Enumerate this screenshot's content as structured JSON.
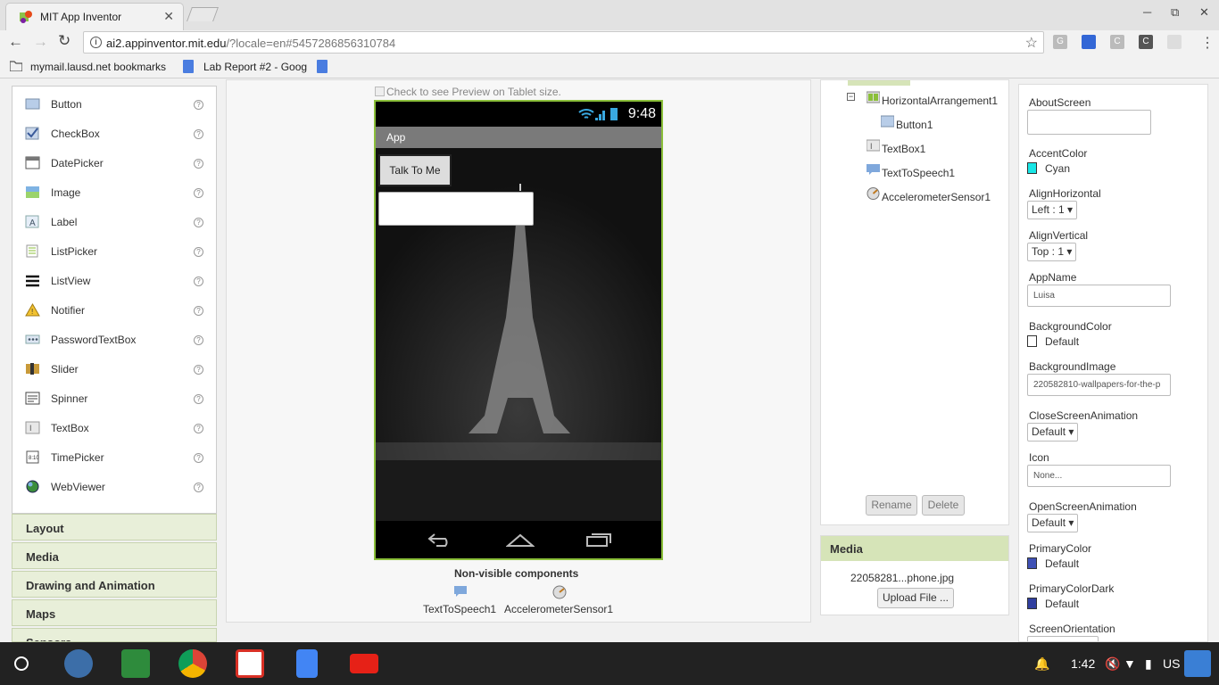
{
  "browser": {
    "tab_title": "MIT App Inventor",
    "tab_close": "✕",
    "url_main": "ai2.appinventor.mit.edu",
    "url_rest": "/?locale=en#5457286856310784",
    "bookmarks": [
      "mymail.lausd.net bookmarks",
      "Lab Report #2 - Goog"
    ]
  },
  "palette": {
    "items": [
      {
        "label": "Button",
        "icon": "button-icon"
      },
      {
        "label": "CheckBox",
        "icon": "checkbox-icon"
      },
      {
        "label": "DatePicker",
        "icon": "datepicker-icon"
      },
      {
        "label": "Image",
        "icon": "image-icon"
      },
      {
        "label": "Label",
        "icon": "label-icon"
      },
      {
        "label": "ListPicker",
        "icon": "listpicker-icon"
      },
      {
        "label": "ListView",
        "icon": "listview-icon"
      },
      {
        "label": "Notifier",
        "icon": "notifier-icon"
      },
      {
        "label": "PasswordTextBox",
        "icon": "passwordtextbox-icon"
      },
      {
        "label": "Slider",
        "icon": "slider-icon"
      },
      {
        "label": "Spinner",
        "icon": "spinner-icon"
      },
      {
        "label": "TextBox",
        "icon": "textbox-icon"
      },
      {
        "label": "TimePicker",
        "icon": "timepicker-icon"
      },
      {
        "label": "WebViewer",
        "icon": "webviewer-icon"
      }
    ],
    "help": "?",
    "drawers": [
      "Layout",
      "Media",
      "Drawing and Animation",
      "Maps",
      "Sensors"
    ]
  },
  "viewer": {
    "tablet_check": "Check to see Preview on Tablet size.",
    "time": "9:48",
    "app_title": "App",
    "button_text": "Talk To Me",
    "nonvisible_title": "Non-visible components",
    "nonvisible": [
      "TextToSpeech1",
      "AccelerometerSensor1"
    ]
  },
  "tree": {
    "nodes": [
      "HorizontalArrangement1",
      "Button1",
      "TextBox1",
      "TextToSpeech1",
      "AccelerometerSensor1"
    ],
    "rename": "Rename",
    "delete": "Delete"
  },
  "media": {
    "title": "Media",
    "file": "22058281...phone.jpg",
    "upload": "Upload File ..."
  },
  "properties": {
    "about": "AboutScreen",
    "accent_label": "AccentColor",
    "accent_value": "Cyan",
    "accent_color": "#18e6e6",
    "alignh_label": "AlignHorizontal",
    "alignh_value": "Left : 1 ▾",
    "alignv_label": "AlignVertical",
    "alignv_value": "Top : 1 ▾",
    "appname_label": "AppName",
    "appname_value": "Luisa",
    "bgcolor_label": "BackgroundColor",
    "bgcolor_value": "Default",
    "bgimage_label": "BackgroundImage",
    "bgimage_value": "220582810-wallpapers-for-the-p",
    "closeanim_label": "CloseScreenAnimation",
    "closeanim_value": "Default ▾",
    "icon_label": "Icon",
    "icon_value": "None...",
    "openanim_label": "OpenScreenAnimation",
    "openanim_value": "Default ▾",
    "primary_label": "PrimaryColor",
    "primary_value": "Default",
    "primary_color": "#3f51b5",
    "primarydark_label": "PrimaryColorDark",
    "primarydark_value": "Default",
    "primarydark_color": "#303f9f",
    "orientation_label": "ScreenOrientation"
  },
  "shelf": {
    "time": "1:42",
    "locale": "US"
  }
}
